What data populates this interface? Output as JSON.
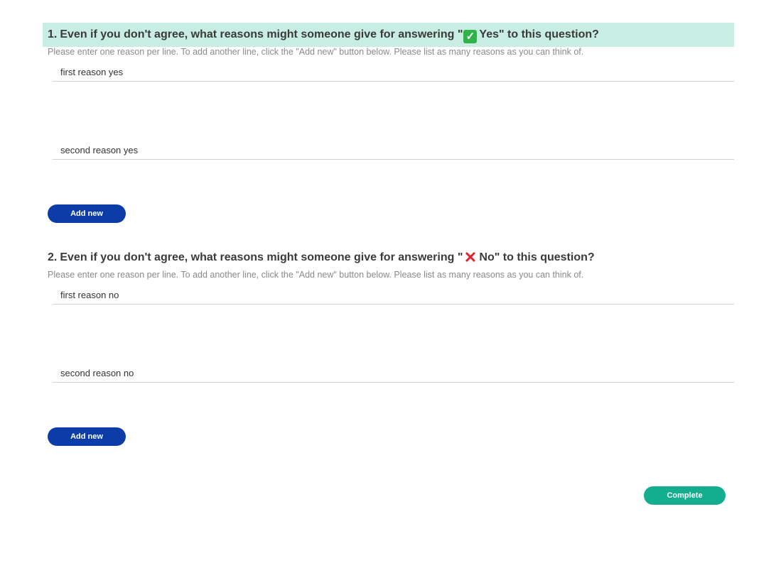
{
  "questions": [
    {
      "number": "1.",
      "title_before": "Even if you don't agree, what reasons might someone give for answering \"",
      "option_icon": "check-mark-button-icon",
      "option_icon_color": "#2fb34a",
      "option_label": "Yes",
      "title_after": "\" to this question?",
      "highlight_color": "#c8ede3",
      "description": "Please enter one reason per line. To add another line, click the \"Add new\" button below. Please list as many reasons as you can think of.",
      "answers": [
        "first reason yes",
        "second reason yes"
      ],
      "add_button_label": "Add new"
    },
    {
      "number": "2.",
      "title_before": "Even if you don't agree, what reasons might someone give for answering \"",
      "option_icon": "cross-mark-icon",
      "option_icon_color": "#e0242b",
      "option_label": "No",
      "title_after": "\" to this question?",
      "description": "Please enter one reason per line. To add another line, click the \"Add new\" button below. Please list as many reasons as you can think of.",
      "answers": [
        "first reason no",
        "second reason no"
      ],
      "add_button_label": "Add new"
    }
  ],
  "complete_button_label": "Complete",
  "colors": {
    "add_button": "#0c3ca8",
    "complete_button": "#13ae8f"
  }
}
